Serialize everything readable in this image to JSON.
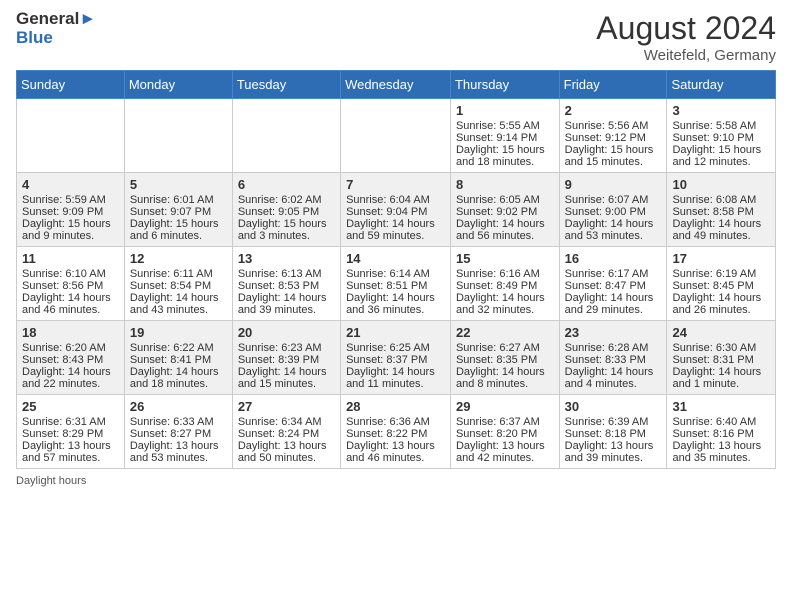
{
  "header": {
    "logo_general": "General",
    "logo_blue": "Blue",
    "month_year": "August 2024",
    "location": "Weitefeld, Germany"
  },
  "days_of_week": [
    "Sunday",
    "Monday",
    "Tuesday",
    "Wednesday",
    "Thursday",
    "Friday",
    "Saturday"
  ],
  "footnote": "Daylight hours",
  "weeks": [
    [
      {
        "day": "",
        "sunrise": "",
        "sunset": "",
        "daylight": ""
      },
      {
        "day": "",
        "sunrise": "",
        "sunset": "",
        "daylight": ""
      },
      {
        "day": "",
        "sunrise": "",
        "sunset": "",
        "daylight": ""
      },
      {
        "day": "",
        "sunrise": "",
        "sunset": "",
        "daylight": ""
      },
      {
        "day": "1",
        "sunrise": "Sunrise: 5:55 AM",
        "sunset": "Sunset: 9:14 PM",
        "daylight": "Daylight: 15 hours and 18 minutes."
      },
      {
        "day": "2",
        "sunrise": "Sunrise: 5:56 AM",
        "sunset": "Sunset: 9:12 PM",
        "daylight": "Daylight: 15 hours and 15 minutes."
      },
      {
        "day": "3",
        "sunrise": "Sunrise: 5:58 AM",
        "sunset": "Sunset: 9:10 PM",
        "daylight": "Daylight: 15 hours and 12 minutes."
      }
    ],
    [
      {
        "day": "4",
        "sunrise": "Sunrise: 5:59 AM",
        "sunset": "Sunset: 9:09 PM",
        "daylight": "Daylight: 15 hours and 9 minutes."
      },
      {
        "day": "5",
        "sunrise": "Sunrise: 6:01 AM",
        "sunset": "Sunset: 9:07 PM",
        "daylight": "Daylight: 15 hours and 6 minutes."
      },
      {
        "day": "6",
        "sunrise": "Sunrise: 6:02 AM",
        "sunset": "Sunset: 9:05 PM",
        "daylight": "Daylight: 15 hours and 3 minutes."
      },
      {
        "day": "7",
        "sunrise": "Sunrise: 6:04 AM",
        "sunset": "Sunset: 9:04 PM",
        "daylight": "Daylight: 14 hours and 59 minutes."
      },
      {
        "day": "8",
        "sunrise": "Sunrise: 6:05 AM",
        "sunset": "Sunset: 9:02 PM",
        "daylight": "Daylight: 14 hours and 56 minutes."
      },
      {
        "day": "9",
        "sunrise": "Sunrise: 6:07 AM",
        "sunset": "Sunset: 9:00 PM",
        "daylight": "Daylight: 14 hours and 53 minutes."
      },
      {
        "day": "10",
        "sunrise": "Sunrise: 6:08 AM",
        "sunset": "Sunset: 8:58 PM",
        "daylight": "Daylight: 14 hours and 49 minutes."
      }
    ],
    [
      {
        "day": "11",
        "sunrise": "Sunrise: 6:10 AM",
        "sunset": "Sunset: 8:56 PM",
        "daylight": "Daylight: 14 hours and 46 minutes."
      },
      {
        "day": "12",
        "sunrise": "Sunrise: 6:11 AM",
        "sunset": "Sunset: 8:54 PM",
        "daylight": "Daylight: 14 hours and 43 minutes."
      },
      {
        "day": "13",
        "sunrise": "Sunrise: 6:13 AM",
        "sunset": "Sunset: 8:53 PM",
        "daylight": "Daylight: 14 hours and 39 minutes."
      },
      {
        "day": "14",
        "sunrise": "Sunrise: 6:14 AM",
        "sunset": "Sunset: 8:51 PM",
        "daylight": "Daylight: 14 hours and 36 minutes."
      },
      {
        "day": "15",
        "sunrise": "Sunrise: 6:16 AM",
        "sunset": "Sunset: 8:49 PM",
        "daylight": "Daylight: 14 hours and 32 minutes."
      },
      {
        "day": "16",
        "sunrise": "Sunrise: 6:17 AM",
        "sunset": "Sunset: 8:47 PM",
        "daylight": "Daylight: 14 hours and 29 minutes."
      },
      {
        "day": "17",
        "sunrise": "Sunrise: 6:19 AM",
        "sunset": "Sunset: 8:45 PM",
        "daylight": "Daylight: 14 hours and 26 minutes."
      }
    ],
    [
      {
        "day": "18",
        "sunrise": "Sunrise: 6:20 AM",
        "sunset": "Sunset: 8:43 PM",
        "daylight": "Daylight: 14 hours and 22 minutes."
      },
      {
        "day": "19",
        "sunrise": "Sunrise: 6:22 AM",
        "sunset": "Sunset: 8:41 PM",
        "daylight": "Daylight: 14 hours and 18 minutes."
      },
      {
        "day": "20",
        "sunrise": "Sunrise: 6:23 AM",
        "sunset": "Sunset: 8:39 PM",
        "daylight": "Daylight: 14 hours and 15 minutes."
      },
      {
        "day": "21",
        "sunrise": "Sunrise: 6:25 AM",
        "sunset": "Sunset: 8:37 PM",
        "daylight": "Daylight: 14 hours and 11 minutes."
      },
      {
        "day": "22",
        "sunrise": "Sunrise: 6:27 AM",
        "sunset": "Sunset: 8:35 PM",
        "daylight": "Daylight: 14 hours and 8 minutes."
      },
      {
        "day": "23",
        "sunrise": "Sunrise: 6:28 AM",
        "sunset": "Sunset: 8:33 PM",
        "daylight": "Daylight: 14 hours and 4 minutes."
      },
      {
        "day": "24",
        "sunrise": "Sunrise: 6:30 AM",
        "sunset": "Sunset: 8:31 PM",
        "daylight": "Daylight: 14 hours and 1 minute."
      }
    ],
    [
      {
        "day": "25",
        "sunrise": "Sunrise: 6:31 AM",
        "sunset": "Sunset: 8:29 PM",
        "daylight": "Daylight: 13 hours and 57 minutes."
      },
      {
        "day": "26",
        "sunrise": "Sunrise: 6:33 AM",
        "sunset": "Sunset: 8:27 PM",
        "daylight": "Daylight: 13 hours and 53 minutes."
      },
      {
        "day": "27",
        "sunrise": "Sunrise: 6:34 AM",
        "sunset": "Sunset: 8:24 PM",
        "daylight": "Daylight: 13 hours and 50 minutes."
      },
      {
        "day": "28",
        "sunrise": "Sunrise: 6:36 AM",
        "sunset": "Sunset: 8:22 PM",
        "daylight": "Daylight: 13 hours and 46 minutes."
      },
      {
        "day": "29",
        "sunrise": "Sunrise: 6:37 AM",
        "sunset": "Sunset: 8:20 PM",
        "daylight": "Daylight: 13 hours and 42 minutes."
      },
      {
        "day": "30",
        "sunrise": "Sunrise: 6:39 AM",
        "sunset": "Sunset: 8:18 PM",
        "daylight": "Daylight: 13 hours and 39 minutes."
      },
      {
        "day": "31",
        "sunrise": "Sunrise: 6:40 AM",
        "sunset": "Sunset: 8:16 PM",
        "daylight": "Daylight: 13 hours and 35 minutes."
      }
    ]
  ]
}
